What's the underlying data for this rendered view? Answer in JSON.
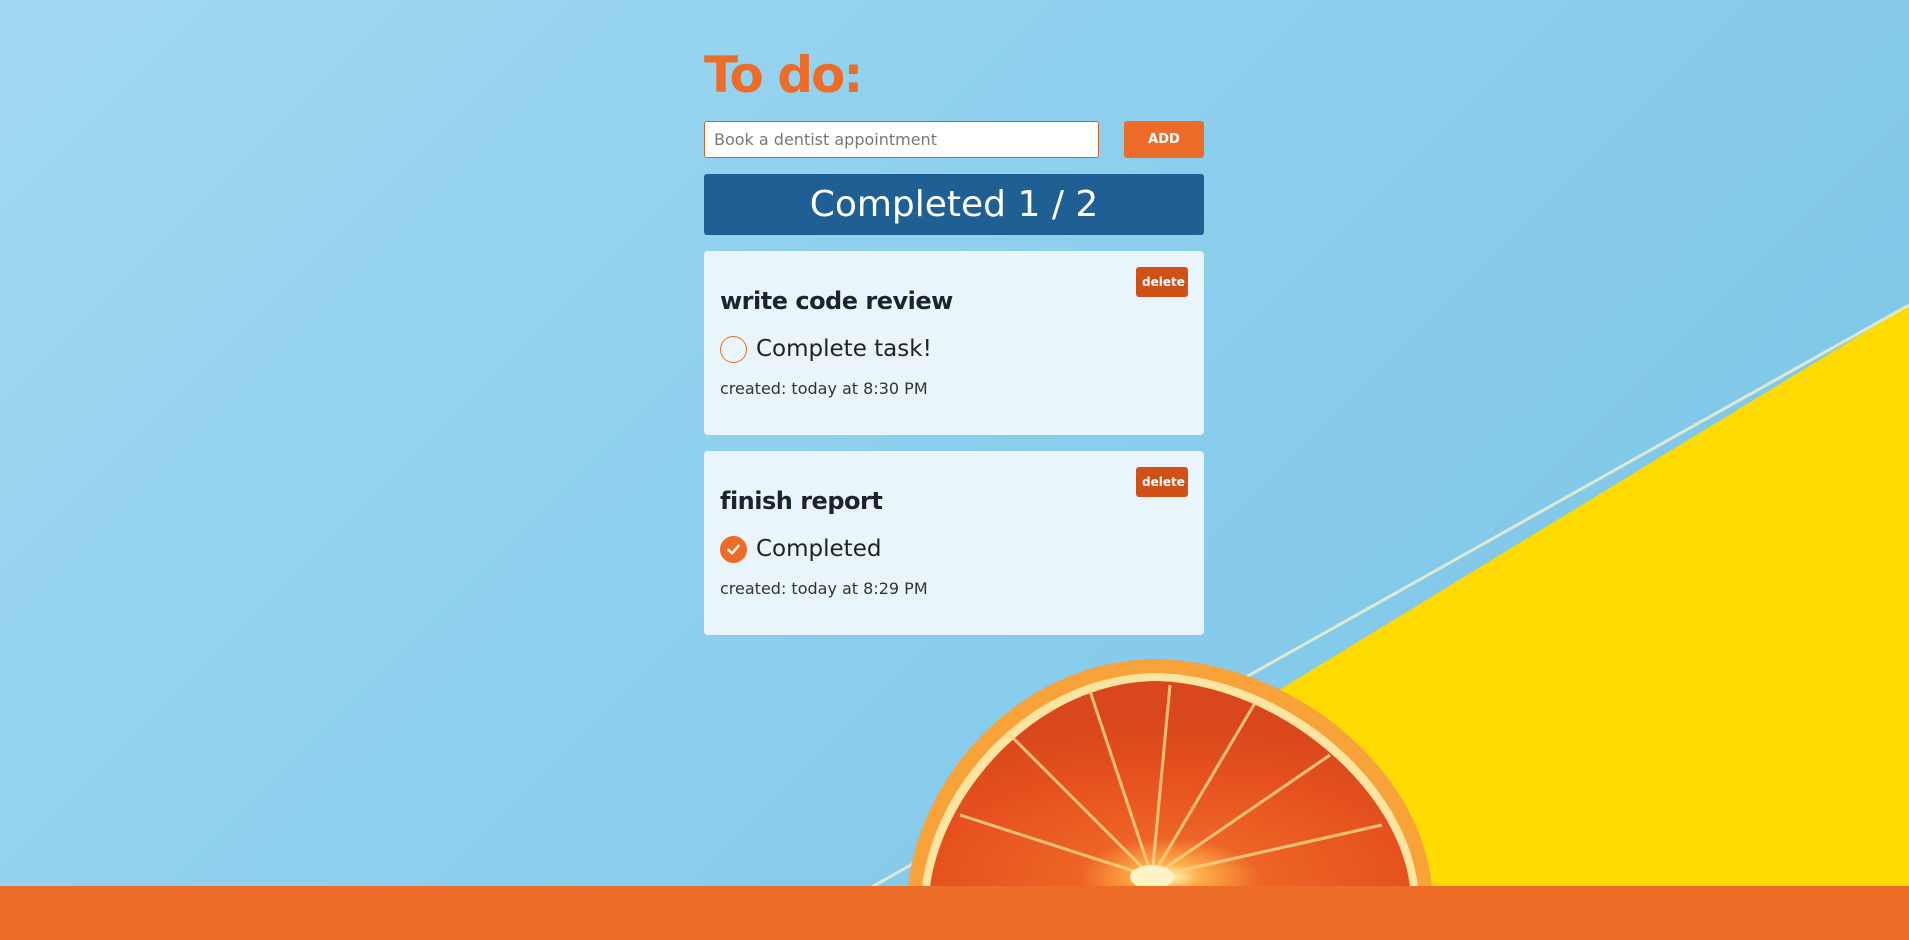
{
  "app": {
    "title": "To do:"
  },
  "add_form": {
    "placeholder": "Book a dentist appointment",
    "add_label": "ADD"
  },
  "summary": {
    "text": "Completed 1 / 2",
    "completed": 1,
    "total": 2
  },
  "tasks": [
    {
      "title": "write code review",
      "status_label": "Complete task!",
      "completed": false,
      "created": "created: today at 8:30 PM",
      "delete_label": "delete"
    },
    {
      "title": "finish report",
      "status_label": "Completed",
      "completed": true,
      "created": "created: today at 8:29 PM",
      "delete_label": "delete"
    }
  ],
  "colors": {
    "accent": "#ec6c28",
    "summary_bg": "#1f5f94",
    "card_bg": "#eaf5fb",
    "delete_bg": "#cf5118",
    "sky": "#8fd0ee",
    "yellow": "#fddb00"
  },
  "icons": {
    "check": "checkmark-icon",
    "background": "grapefruit-image"
  }
}
